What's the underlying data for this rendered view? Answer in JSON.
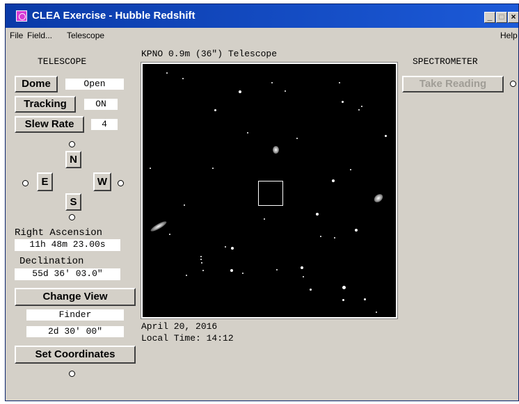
{
  "window": {
    "title": "CLEA Exercise - Hubble Redshift",
    "minimize_glyph": "_",
    "maximize_glyph": "□",
    "close_glyph": "×"
  },
  "menu": {
    "file": "File",
    "field": "Field...",
    "telescope": "Telescope",
    "help": "Help"
  },
  "telescope": {
    "section_title": "TELESCOPE",
    "dome_label": "Dome",
    "dome_value": "Open",
    "tracking_label": "Tracking",
    "tracking_value": "ON",
    "slew_label": "Slew Rate",
    "slew_value": "4",
    "north": "N",
    "east": "E",
    "west": "W",
    "south": "S"
  },
  "coordinates": {
    "ra_label": "Right Ascension",
    "ra_value": "11h 48m 23.00s",
    "dec_label": "Declination",
    "dec_value": "55d 36' 03.0\""
  },
  "view_controls": {
    "change_view_label": "Change View",
    "view_mode": "Finder",
    "field_size": "2d 30' 00\"",
    "set_coordinates_label": "Set Coordinates"
  },
  "viewport": {
    "title": "KPNO 0.9m (36\") Telescope",
    "date": "April 20, 2016",
    "local_time": "Local Time: 14:12"
  },
  "spectrometer": {
    "section_title": "SPECTROMETER",
    "take_reading_label": "Take Reading"
  }
}
